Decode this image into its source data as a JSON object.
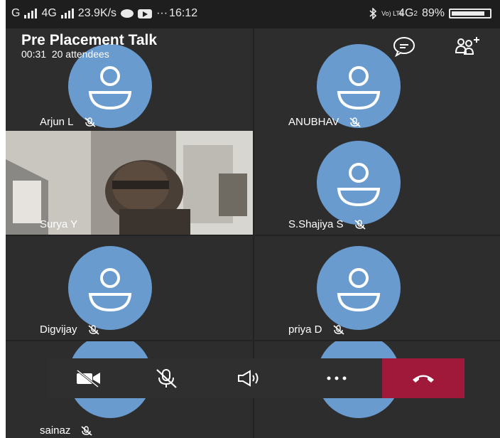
{
  "status_bar": {
    "carrier_left": "G",
    "net1": "4G",
    "speed": "23.9K/s",
    "dots": "···",
    "time": "16:12",
    "volte": "Vo) LTE",
    "net2": "4G",
    "sim2": "2",
    "battery_pct": "89%",
    "battery_level": 0.89
  },
  "call": {
    "title": "Pre Placement Talk",
    "duration": "00:31",
    "attendees": "20 attendees"
  },
  "participants": [
    {
      "name": "Arjun L",
      "muted": true
    },
    {
      "name": "ANUBHAV",
      "muted": true
    },
    {
      "name": "Surya Y",
      "muted": false,
      "video": true
    },
    {
      "name": "S.Shajiya S",
      "muted": true
    },
    {
      "name": "Digvijay",
      "muted": true
    },
    {
      "name": "priya D",
      "muted": true
    },
    {
      "name": "sainaz",
      "muted": true
    }
  ],
  "controls": [
    "camera-off",
    "mic-off",
    "speaker",
    "more",
    "hang-up"
  ],
  "colors": {
    "avatar": "#6a9bcf",
    "hangup": "#a0193a",
    "background": "#232323"
  }
}
